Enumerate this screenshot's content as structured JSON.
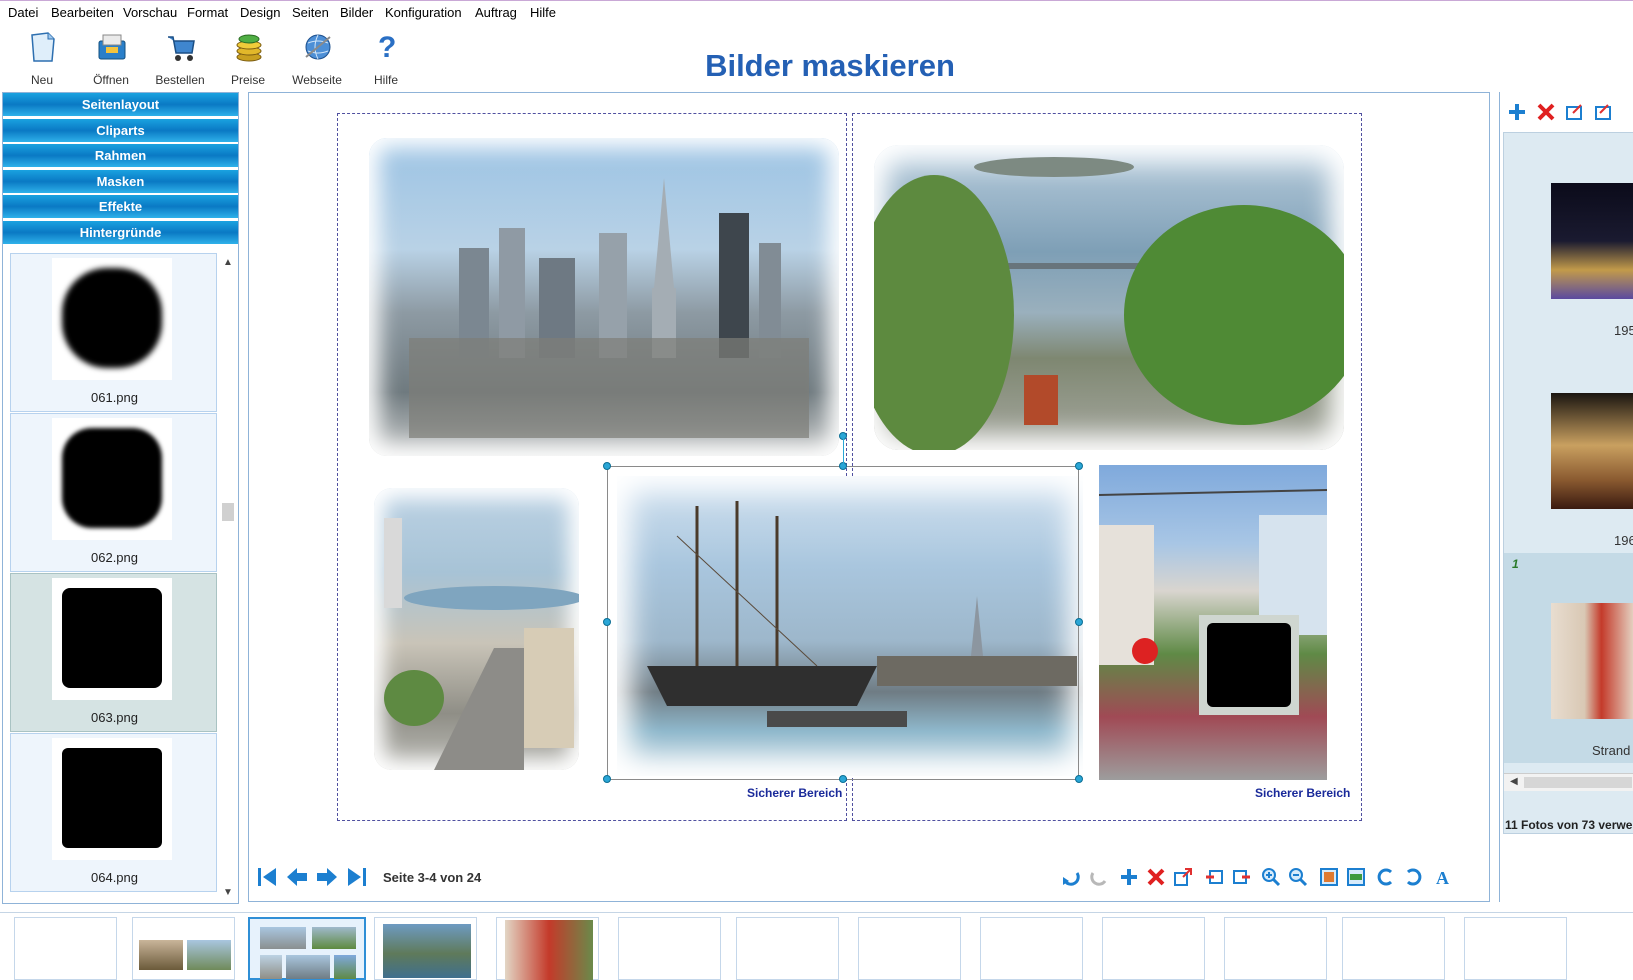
{
  "menu": [
    "Datei",
    "Bearbeiten",
    "Vorschau",
    "Format",
    "Design",
    "Seiten",
    "Bilder",
    "Konfiguration",
    "Auftrag",
    "Hilfe"
  ],
  "toolbar": {
    "buttons": [
      {
        "label": "Neu",
        "icon": "new-document-icon"
      },
      {
        "label": "Öffnen",
        "icon": "open-folder-icon"
      },
      {
        "label": "Bestellen",
        "icon": "shopping-cart-icon"
      },
      {
        "label": "Preise",
        "icon": "coins-icon"
      },
      {
        "label": "Webseite",
        "icon": "globe-icon"
      },
      {
        "label": "Hilfe",
        "icon": "question-icon"
      }
    ]
  },
  "title": "Bilder maskieren",
  "sidebar": {
    "categories": [
      "Seitenlayout",
      "Cliparts",
      "Rahmen",
      "Masken",
      "Effekte",
      "Hintergründe"
    ],
    "masks": [
      {
        "name": "061.png",
        "selected": false
      },
      {
        "name": "062.png",
        "selected": false
      },
      {
        "name": "063.png",
        "selected": true
      },
      {
        "name": "064.png",
        "selected": false
      }
    ]
  },
  "canvas": {
    "safe_area_label": "Sicherer Bereich",
    "page_indicator": "Seite 3-4 von 24"
  },
  "right_panel": {
    "items": [
      {
        "caption": "195"
      },
      {
        "caption": "196"
      },
      {
        "caption": "Strand",
        "badge": "1"
      }
    ],
    "status": "11 Fotos von 73 verwe"
  },
  "colors": {
    "accent": "#2460b4",
    "category_bg": "#0a79c4",
    "safe_label": "#1a2a9a",
    "handle": "#2aa6d6"
  }
}
